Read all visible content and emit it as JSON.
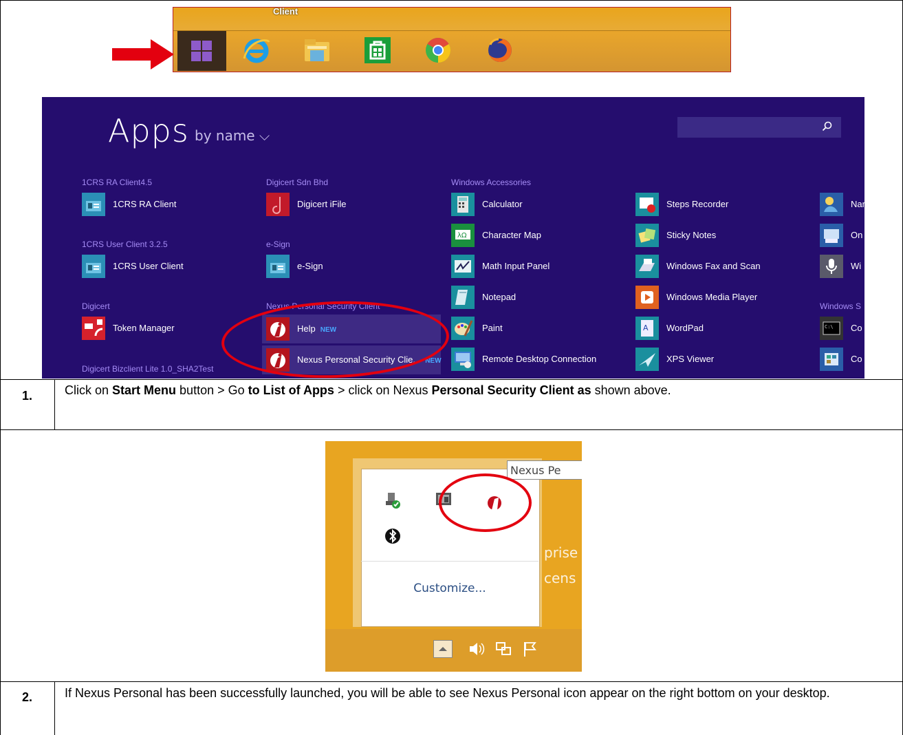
{
  "taskbar": {
    "client_label": "Client",
    "icons": [
      "windows-start-icon",
      "internet-explorer-icon",
      "file-explorer-icon",
      "store-icon",
      "chrome-icon",
      "firefox-icon"
    ]
  },
  "apps": {
    "title": "Apps",
    "sort_label": "by name ⌵",
    "columns": [
      {
        "groups": [
          {
            "name": "1CRS RA Client4.5",
            "apps": [
              "1CRS RA Client"
            ]
          },
          {
            "name": "1CRS User Client 3.2.5",
            "apps": [
              "1CRS User Client"
            ]
          },
          {
            "name": "Digicert",
            "apps": [
              "Token Manager"
            ]
          },
          {
            "name": "Digicert Bizclient Lite 1.0_SHA2Test",
            "apps": []
          }
        ]
      },
      {
        "groups": [
          {
            "name": "Digicert Sdn Bhd",
            "apps": [
              "Digicert iFile"
            ]
          },
          {
            "name": "e-Sign",
            "apps": [
              "e-Sign"
            ]
          },
          {
            "name": "Nexus Personal Security Client",
            "apps": [
              "Help",
              "Nexus Personal Security Clie..."
            ]
          }
        ],
        "new_badge": "NEW",
        "new_badge_cut": "NEW"
      },
      {
        "groups": [
          {
            "name": "Windows Accessories",
            "apps": [
              "Calculator",
              "Character Map",
              "Math Input Panel",
              "Notepad",
              "Paint",
              "Remote Desktop Connection"
            ]
          }
        ]
      },
      {
        "apps": [
          "Steps Recorder",
          "Sticky Notes",
          "Windows Fax and Scan",
          "Windows Media Player",
          "WordPad",
          "XPS Viewer"
        ]
      },
      {
        "apps": [
          "Nar",
          "On",
          "Wi",
          "Co",
          "Co"
        ],
        "group": "Windows S"
      }
    ]
  },
  "steps": [
    {
      "num": "1.",
      "parts": [
        "Click on ",
        "Start Menu",
        " button > Go ",
        "to List of Apps",
        " > click on Nexus ",
        "Personal Security Client as",
        " shown above."
      ]
    },
    {
      "num": "2.",
      "text": "If Nexus Personal has been successfully launched, you will be able to see Nexus Personal icon appear on the right bottom on your desktop."
    }
  ],
  "tray": {
    "tooltip": "Nexus Pe",
    "customize": "Customize...",
    "bg_text_1": "prise",
    "bg_text_2": "cens"
  },
  "colors": {
    "apps_bg": "#250d6e",
    "group_label": "#a58cf5",
    "highlight_circle": "#e3000f",
    "taskbar": "#e8a52b",
    "new_badge": "#49a8ff"
  }
}
